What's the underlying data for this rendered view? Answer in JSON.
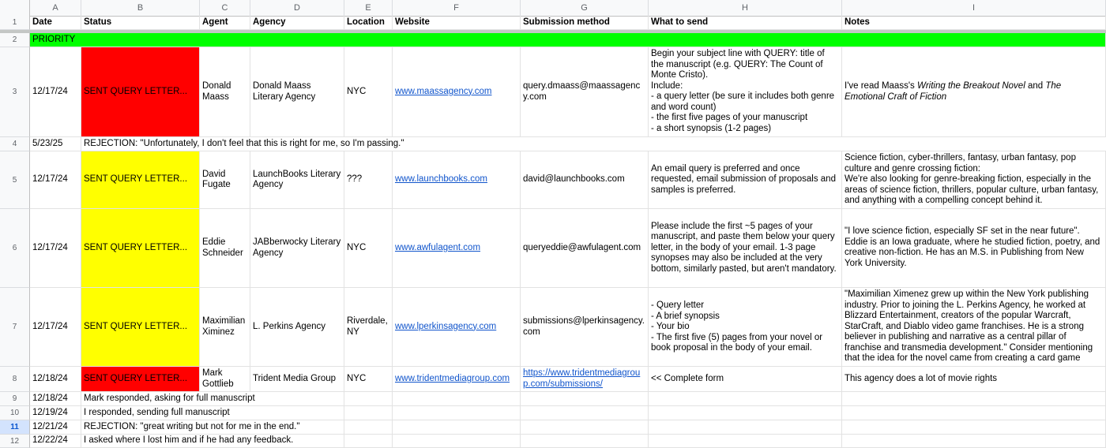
{
  "columns": [
    "A",
    "B",
    "C",
    "D",
    "E",
    "F",
    "G",
    "H",
    "I"
  ],
  "header": {
    "date": "Date",
    "status": "Status",
    "agent": "Agent",
    "agency": "Agency",
    "location": "Location",
    "website": "Website",
    "submission": "Submission method",
    "what": "What to send",
    "notes": "Notes"
  },
  "rows": {
    "r2": {
      "num": "2",
      "label": "PRIORITY"
    },
    "r3": {
      "num": "3",
      "date": "12/17/24",
      "status": "SENT QUERY LETTER...",
      "agent": "Donald Maass",
      "agency": "Donald Maass Literary Agency",
      "location": "NYC",
      "website": "www.maassagency.com",
      "submission": "query.dmaass@maassagency.com",
      "what_1": "Begin your subject line with QUERY: title of the manuscript (e.g. QUERY: The Count of Monte Cristo).",
      "what_2": "Include:",
      "what_3": "- a query letter (be sure it includes both genre and word count)",
      "what_4": "- the first five pages of your manuscript",
      "what_5": "- a short synopsis (1-2 pages)",
      "notes_a": "I've read Maass's ",
      "notes_b": "Writing the Breakout Novel",
      "notes_c": " and ",
      "notes_d": "The Emotional Craft of Fiction"
    },
    "r4": {
      "num": "4",
      "date": "5/23/25",
      "text": "REJECTION: \"Unfortunately, I don't feel that this is right for me, so I'm passing.\""
    },
    "r5": {
      "num": "5",
      "date": "12/17/24",
      "status": "SENT QUERY LETTER...",
      "agent": "David Fugate",
      "agency": "LaunchBooks Literary Agency",
      "location": "???",
      "website": "www.launchbooks.com",
      "submission": "david@launchbooks.com",
      "what": "An email query is preferred and once requested, email submission of proposals and samples is preferred.",
      "notes_1": "Science fiction, cyber-thrillers, fantasy, urban fantasy, pop culture and genre crossing fiction:",
      "notes_2": "We're also looking for genre-breaking fiction, especially in the areas of science fiction, thrillers, popular culture, urban fantasy, and anything with a compelling concept behind it."
    },
    "r6": {
      "num": "6",
      "date": "12/17/24",
      "status": "SENT QUERY LETTER...",
      "agent": "Eddie Schneider",
      "agency": "JABberwocky Literary Agency",
      "location": "NYC",
      "website": "www.awfulagent.com",
      "submission": "queryeddie@awfulagent.com",
      "what": "Please include the first ~5 pages of your manuscript, and paste them below your query letter, in the body of your email. 1-3 page synopses may also be included at the very bottom, similarly pasted, but aren't mandatory.",
      "notes_1": "\"I love science fiction, especially SF set in the near future\".",
      "notes_2": "Eddie is an Iowa graduate, where he studied fiction, poetry, and creative non-fiction. He has an M.S. in Publishing from New York University."
    },
    "r7": {
      "num": "7",
      "date": "12/17/24",
      "status": "SENT QUERY LETTER...",
      "agent": "Maximilian Ximinez",
      "agency": "L. Perkins Agency",
      "location": "Riverdale, NY",
      "website": "www.lperkinsagency.com",
      "submission": "submissions@lperkinsagency.com",
      "what_1": "- Query letter",
      "what_2": "- A brief synopsis",
      "what_3": "- Your bio",
      "what_4": "- The first five (5) pages from your novel or book proposal in the body of your email.",
      "notes": "\"Maximilian Ximenez grew up within the New York publishing industry. Prior to joining the L. Perkins Agency, he worked at Blizzard Entertainment, creators of the popular Warcraft, StarCraft, and Diablo video game franchises. He is a strong believer in publishing and narrative as a central pillar of franchise and transmedia development.\" Consider mentioning that the idea for the novel came from creating a card game"
    },
    "r8": {
      "num": "8",
      "date": "12/18/24",
      "status": "SENT QUERY LETTER...",
      "agent": "Mark Gottlieb",
      "agency": "Trident Media Group",
      "location": "NYC",
      "website": "www.tridentmediagroup.com",
      "submission": "https://www.tridentmediagroup.com/submissions/",
      "what": "<< Complete form",
      "notes": "This agency does a lot of movie rights"
    },
    "r9": {
      "num": "9",
      "date": "12/18/24",
      "text": "Mark responded, asking for full manuscript"
    },
    "r10": {
      "num": "10",
      "date": "12/19/24",
      "text": "I responded, sending full manuscript"
    },
    "r11": {
      "num": "11",
      "date": "12/21/24",
      "text": "REJECTION: \"great writing but not for me in the end.\""
    },
    "r12": {
      "num": "12",
      "date": "12/22/24",
      "text": "I asked where I lost him and if he had any feedback."
    }
  },
  "colors": {
    "red": "#ff0000",
    "yellow": "#ffff00",
    "green": "#00ff00",
    "link": "#1155cc"
  }
}
